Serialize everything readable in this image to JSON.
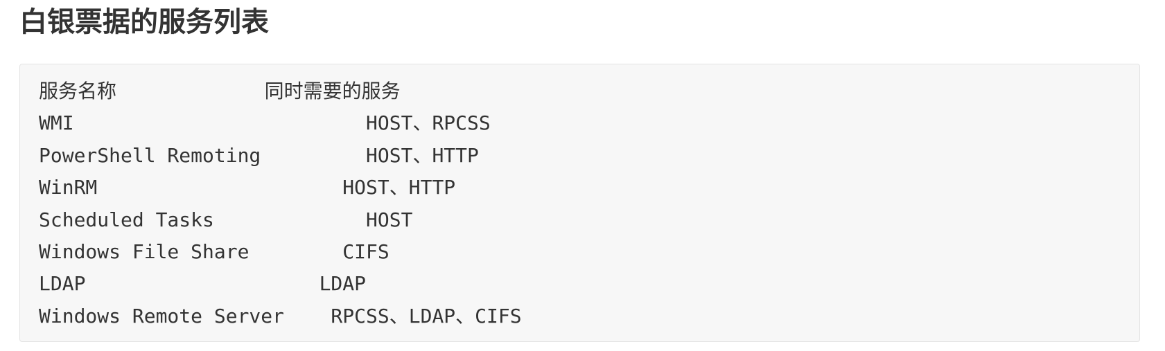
{
  "title": "白银票据的服务列表",
  "code_block": {
    "lines": [
      "服务名称                        同时需要的服务",
      "WMI                         HOST、RPCSS",
      "PowerShell Remoting         HOST、HTTP",
      "WinRM                     HOST、HTTP",
      "Scheduled Tasks             HOST",
      "Windows File Share        CIFS",
      "LDAP                    LDAP",
      "Windows Remote Server    RPCSS、LDAP、CIFS"
    ]
  }
}
